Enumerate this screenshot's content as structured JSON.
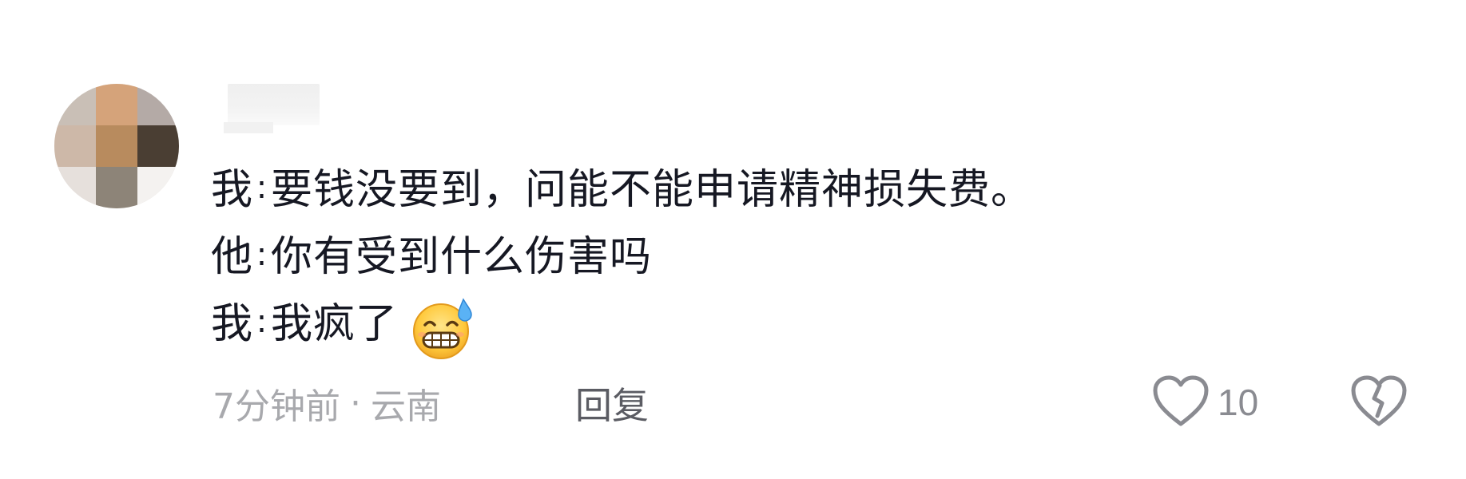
{
  "comment": {
    "lines": [
      {
        "speaker": "我",
        "colon": ":",
        "text": "要钱没要到，问能不能申请精神损失费。"
      },
      {
        "speaker": "他",
        "colon": ":",
        "text": "你有受到什么伤害吗"
      },
      {
        "speaker": "我",
        "colon": ":",
        "text": "我疯了",
        "emoji": "grinning-sweat-emoji"
      }
    ],
    "meta": {
      "time": "7分钟前",
      "separator": "·",
      "location": "云南"
    },
    "reply_label": "回复",
    "like_count": "10"
  },
  "icons": {
    "like": "heart-outline-icon",
    "dislike": "broken-heart-icon"
  },
  "colors": {
    "text": "#161823",
    "meta": "#a8a9ad",
    "reply": "#5b5c63",
    "icon": "#8a8b91"
  }
}
